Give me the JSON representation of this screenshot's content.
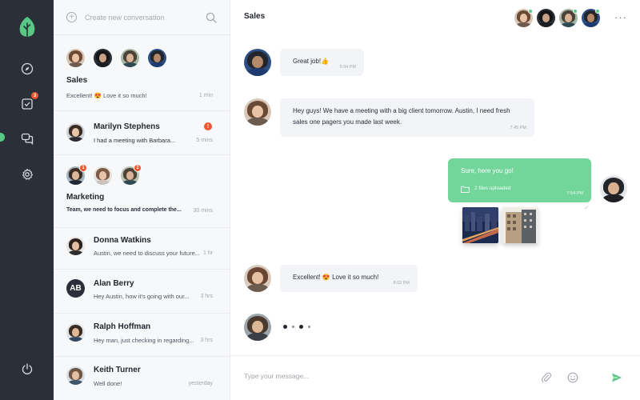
{
  "colors": {
    "rail": "#2b3038",
    "accent": "#58c985",
    "alert": "#f0542d",
    "my_bubble": "#72d69a"
  },
  "rail": {
    "icons": [
      "leaf-logo-icon",
      "compass-icon",
      "tasks-icon",
      "chat-icon",
      "gear-icon",
      "power-icon"
    ],
    "tasks_badge": "3"
  },
  "list": {
    "new_conversation": "Create new conversation",
    "plus_glyph": "+",
    "conversations": [
      {
        "name": "Sales",
        "preview": "Excellent! 😍 Love it so much!",
        "time": "1 min"
      },
      {
        "name": "Marilyn Stephens",
        "preview": "I had a meeting with Barbara...",
        "time": "5 mins",
        "alert": "!"
      },
      {
        "name": "Marketing",
        "preview": "Team, we need to focus and complete the...",
        "time": "30 mins",
        "badges": [
          "1",
          "2"
        ]
      },
      {
        "name": "Donna Watkins",
        "preview": "Austin, we need to discuss your future...",
        "time": "1 hr"
      },
      {
        "name": "Alan Berry",
        "initials": "AB",
        "preview": "Hey Austin, how it's going with our...",
        "time": "3 hrs"
      },
      {
        "name": "Ralph Hoffman",
        "preview": "Hey man, just checking in regarding...",
        "time": "3 hrs"
      },
      {
        "name": "Keith Turner",
        "preview": "Well done!",
        "time": "yesterday"
      }
    ]
  },
  "chat": {
    "title": "Sales",
    "more_glyph": "···",
    "messages": [
      {
        "text": "Great job!👍",
        "time": "5:04 PM"
      },
      {
        "text": "Hey guys! We have a meeting with a big client tomorrow. Austin, I need fresh sales one pagers you made last week.",
        "time": "7:45 PM"
      },
      {
        "text": "Sure, here you go!",
        "files": "2 files uploaded",
        "time": "7:54 PM"
      },
      {
        "text": "Excellent! 😍  Love it so much!",
        "time": "8:02 PM"
      }
    ],
    "read_glyph": "✓",
    "composer_placeholder": "Type your message..."
  }
}
